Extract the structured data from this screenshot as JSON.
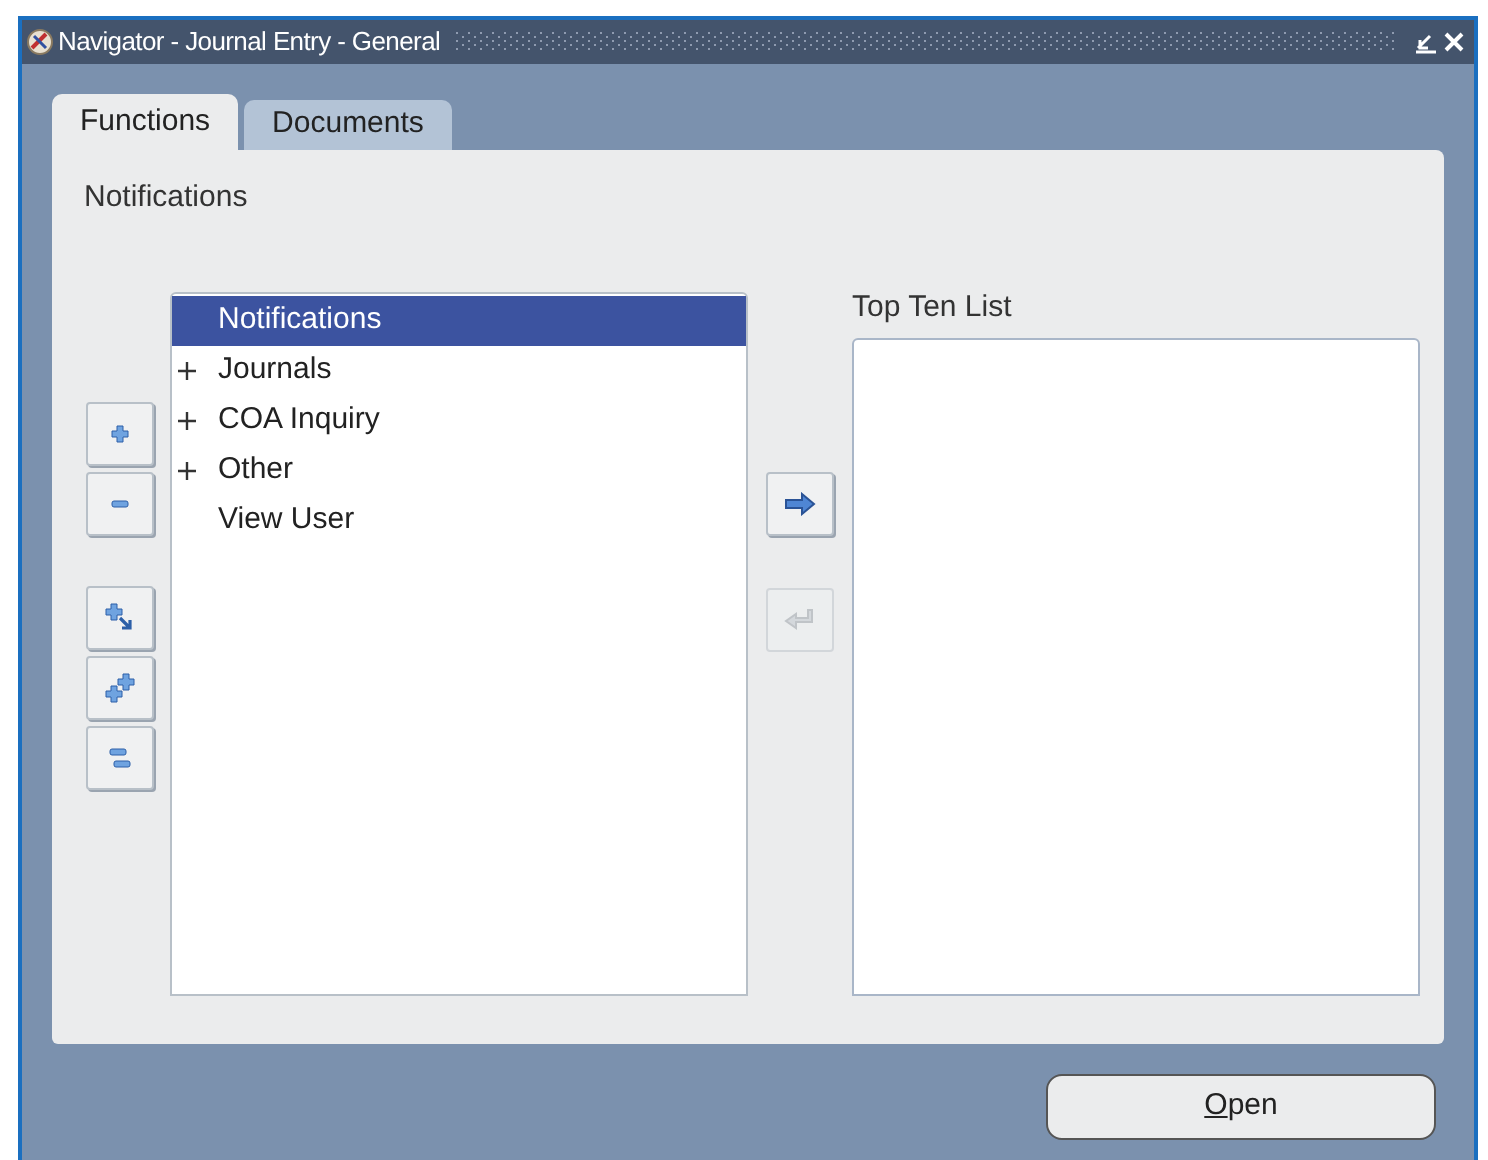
{
  "window": {
    "title": "Navigator - Journal Entry - General"
  },
  "tabs": [
    {
      "label": "Functions",
      "selected": true
    },
    {
      "label": "Documents",
      "selected": false
    }
  ],
  "section_label": "Notifications",
  "tree_tools": [
    {
      "kind": "expand",
      "disabled": false
    },
    {
      "kind": "collapse",
      "disabled": false
    },
    {
      "kind": "expand-branch",
      "disabled": false
    },
    {
      "kind": "expand-all",
      "disabled": false
    },
    {
      "kind": "collapse-all",
      "disabled": false
    }
  ],
  "tree": [
    {
      "label": "Notifications",
      "expandable": false,
      "selected": true
    },
    {
      "label": "Journals",
      "expandable": true,
      "selected": false
    },
    {
      "label": "COA Inquiry",
      "expandable": true,
      "selected": false
    },
    {
      "label": "Other",
      "expandable": true,
      "selected": false
    },
    {
      "label": "View User",
      "expandable": false,
      "selected": false
    }
  ],
  "move_buttons": [
    {
      "kind": "add",
      "disabled": false
    },
    {
      "kind": "remove",
      "disabled": true
    }
  ],
  "top_ten": {
    "label": "Top Ten List"
  },
  "open_button": {
    "label": "Open",
    "mnemonic_first": true
  }
}
